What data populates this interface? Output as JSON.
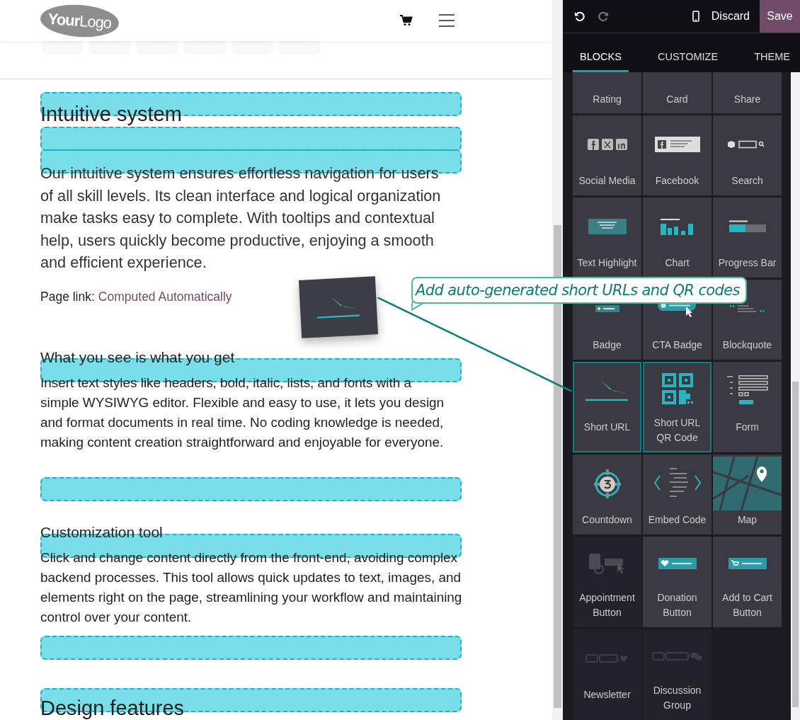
{
  "header": {
    "logo": "**Your**Logo"
  },
  "page": {
    "sections": [
      {
        "heading": "Intuitive system",
        "kind": "title",
        "body": "Our intuitive system ensures effortless navigation for users of all skill levels. Its clean interface and logical organization make tasks easy to complete. With tooltips and contextual help, users quickly become productive, enjoying a smooth and efficient experience.",
        "page_link": {
          "label": "Page link:",
          "link": "Computed Automatically"
        }
      },
      {
        "heading": "What you see is what you get",
        "kind": "subheading",
        "body": "Insert text styles like headers, bold, italic, lists, and fonts with a simple WYSIWYG editor. Flexible and easy to use, it lets you design and format documents in real time. No coding knowledge is needed, making content creation straightforward and enjoyable for everyone."
      },
      {
        "heading": "Customization tool",
        "kind": "subheading",
        "body": "Click and change content directly from the front-end, avoiding complex backend processes. This tool allows quick updates to text, images, and elements right on the page, streamlining your workflow and maintaining control over your content."
      },
      {
        "heading": "Design features",
        "kind": "title"
      }
    ]
  },
  "editor": {
    "toolbar": {
      "undo": {
        "disabled": false
      },
      "redo": {
        "disabled": true
      },
      "discard": "Discard",
      "save": "Save"
    },
    "tabs": [
      {
        "label": "BLOCKS",
        "selected": true
      },
      {
        "label": "CUSTOMIZE",
        "selected": false
      },
      {
        "label": "THEME",
        "selected": false
      }
    ],
    "blocks": [
      {
        "label": "Rating",
        "kind": "cut",
        "disabled": false,
        "highlighted": false
      },
      {
        "label": "Card",
        "kind": "cut",
        "disabled": false,
        "highlighted": false
      },
      {
        "label": "Share",
        "kind": "cut",
        "disabled": false,
        "highlighted": false
      },
      {
        "label": "Social Media",
        "kind": "social",
        "disabled": false,
        "highlighted": false
      },
      {
        "label": "Facebook",
        "kind": "facebook",
        "disabled": false,
        "highlighted": false
      },
      {
        "label": "Search",
        "kind": "search",
        "disabled": false,
        "highlighted": false
      },
      {
        "label": "Text Highlight",
        "kind": "highlight",
        "disabled": false,
        "highlighted": false
      },
      {
        "label": "Chart",
        "kind": "chart",
        "disabled": false,
        "highlighted": false
      },
      {
        "label": "Progress Bar",
        "kind": "progress",
        "disabled": false,
        "highlighted": false
      },
      {
        "label": "Badge",
        "kind": "badge",
        "disabled": false,
        "highlighted": false
      },
      {
        "label": "CTA Badge",
        "kind": "cta",
        "disabled": false,
        "highlighted": false
      },
      {
        "label": "Blockquote",
        "kind": "quote",
        "disabled": false,
        "highlighted": false
      },
      {
        "label": "Short URL",
        "kind": "shorturl",
        "disabled": false,
        "highlighted": true
      },
      {
        "label": "Short URL QR Code",
        "kind": "qr",
        "disabled": false,
        "highlighted": true
      },
      {
        "label": "Form",
        "kind": "form",
        "disabled": false,
        "highlighted": false
      },
      {
        "label": "Countdown",
        "kind": "countdown",
        "disabled": false,
        "highlighted": false
      },
      {
        "label": "Embed Code",
        "kind": "embed",
        "disabled": false,
        "highlighted": false
      },
      {
        "label": "Map",
        "kind": "map",
        "disabled": false,
        "highlighted": false
      },
      {
        "label": "Appointment Button",
        "kind": "appointment",
        "disabled": true,
        "highlighted": false
      },
      {
        "label": "Donation Button",
        "kind": "donation",
        "disabled": false,
        "highlighted": false
      },
      {
        "label": "Add to Cart Button",
        "kind": "cart",
        "disabled": false,
        "highlighted": false
      },
      {
        "label": "Newsletter",
        "kind": "newsletter",
        "disabled": true,
        "highlighted": false
      },
      {
        "label": "Discussion Group",
        "kind": "discussion",
        "disabled": true,
        "highlighted": false
      }
    ]
  },
  "drag": {
    "tooltip": "Add auto-generated short URLs and QR codes"
  }
}
